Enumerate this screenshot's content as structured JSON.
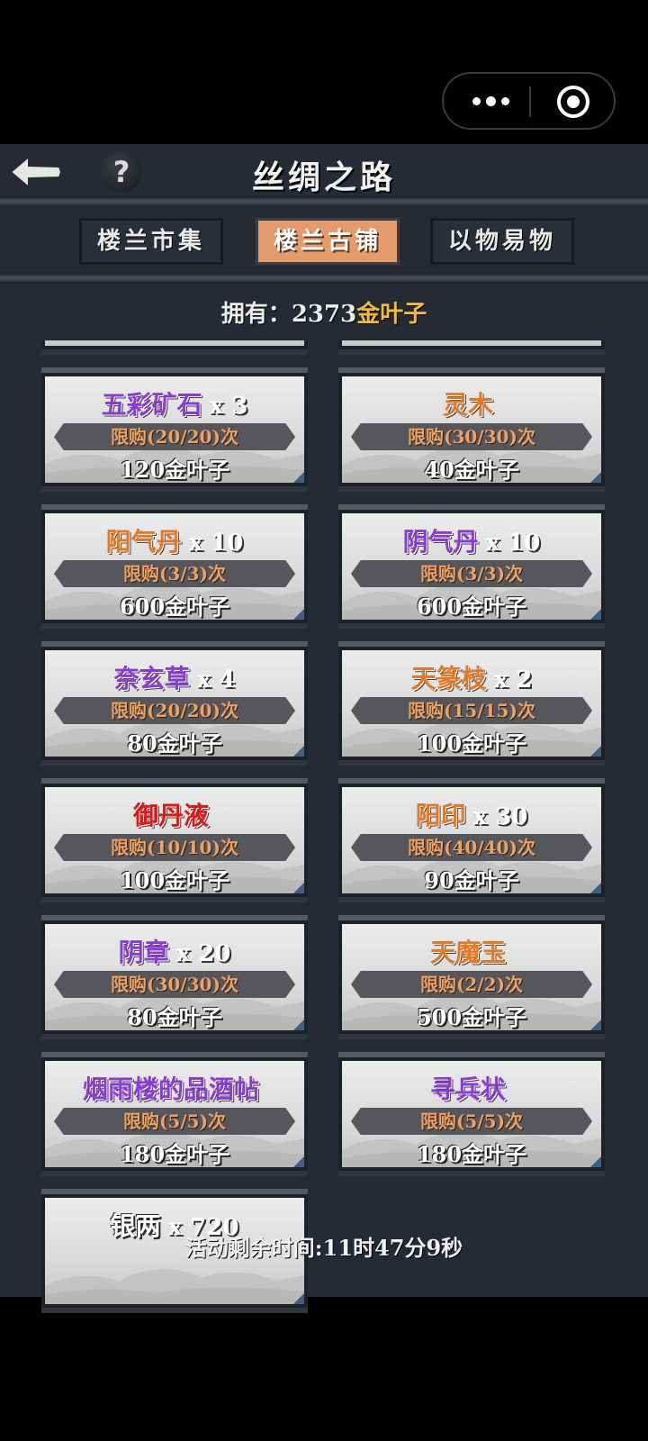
{
  "header": {
    "title": "丝绸之路"
  },
  "tabs": [
    {
      "label": "楼兰市集",
      "active": false
    },
    {
      "label": "楼兰古铺",
      "active": true
    },
    {
      "label": "以物易物",
      "active": false
    }
  ],
  "owned": {
    "label": "拥有：",
    "amount": "2373",
    "currency": "金叶子"
  },
  "items": [
    {
      "name": "五彩矿石",
      "qty": "x 3",
      "color": "purple",
      "limit": "限购(20/20)次",
      "price": "120金叶子"
    },
    {
      "name": "灵木",
      "qty": "",
      "color": "orange",
      "limit": "限购(30/30)次",
      "price": "40金叶子"
    },
    {
      "name": "阳气丹",
      "qty": "x 10",
      "color": "orange",
      "limit": "限购(3/3)次",
      "price": "600金叶子"
    },
    {
      "name": "阴气丹",
      "qty": "x 10",
      "color": "purple",
      "limit": "限购(3/3)次",
      "price": "600金叶子"
    },
    {
      "name": "奈玄草",
      "qty": "x 4",
      "color": "purple",
      "limit": "限购(20/20)次",
      "price": "80金叶子"
    },
    {
      "name": "天篆枝",
      "qty": "x 2",
      "color": "orange",
      "limit": "限购(15/15)次",
      "price": "100金叶子"
    },
    {
      "name": "御丹液",
      "qty": "",
      "color": "red",
      "limit": "限购(10/10)次",
      "price": "100金叶子"
    },
    {
      "name": "阳印",
      "qty": "x 30",
      "color": "orange",
      "limit": "限购(40/40)次",
      "price": "90金叶子"
    },
    {
      "name": "阴章",
      "qty": "x 20",
      "color": "purple",
      "limit": "限购(30/30)次",
      "price": "80金叶子"
    },
    {
      "name": "天魔玉",
      "qty": "",
      "color": "orange",
      "limit": "限购(2/2)次",
      "price": "500金叶子"
    },
    {
      "name": "烟雨楼的品酒帖",
      "qty": "",
      "color": "purple",
      "limit": "限购(5/5)次",
      "price": "180金叶子"
    },
    {
      "name": "寻兵状",
      "qty": "",
      "color": "purple",
      "limit": "限购(5/5)次",
      "price": "180金叶子"
    },
    {
      "name": "银两",
      "qty": "x 720",
      "color": "white",
      "limit": "",
      "price": ""
    }
  ],
  "footer": {
    "timer": "活动剩余时间:11时47分9秒"
  },
  "colors": {
    "background": "#252a34",
    "active_tab": "#e49a6a",
    "gold": "#f3bb3a",
    "rarity_purple": "#8a3bd1",
    "rarity_orange": "#e07a2a",
    "rarity_red": "#e01818"
  },
  "icons": {
    "back": "back-arrow-icon",
    "help": "help-icon",
    "more": "more-dots-icon",
    "close": "target-circle-icon"
  }
}
